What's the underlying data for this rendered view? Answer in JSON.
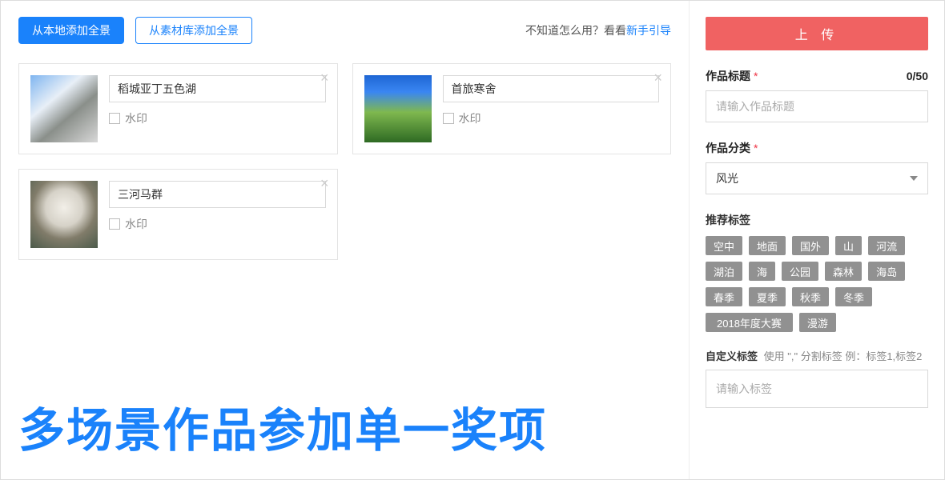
{
  "topbar": {
    "add_local": "从本地添加全景",
    "add_library": "从素材库添加全景",
    "help_prefix": "不知道怎么用？看看",
    "help_link": "新手引导"
  },
  "cards": [
    {
      "title": "稻城亚丁五色湖",
      "watermark_label": "水印"
    },
    {
      "title": "首旅寒舍",
      "watermark_label": "水印"
    },
    {
      "title": "三河马群",
      "watermark_label": "水印"
    }
  ],
  "banner": "多场景作品参加单一奖项",
  "side": {
    "upload": "上 传",
    "title_label": "作品标题",
    "title_counter": "0/50",
    "title_placeholder": "请输入作品标题",
    "category_label": "作品分类",
    "category_value": "风光",
    "tags_label": "推荐标签",
    "tags": [
      "空中",
      "地面",
      "国外",
      "山",
      "河流",
      "湖泊",
      "海",
      "公园",
      "森林",
      "海岛",
      "春季",
      "夏季",
      "秋季",
      "冬季",
      "2018年度大赛",
      "漫游"
    ],
    "custom_label": "自定义标签",
    "custom_hint": "使用 \",\" 分割标签  例：标签1,标签2",
    "custom_placeholder": "请输入标签"
  }
}
